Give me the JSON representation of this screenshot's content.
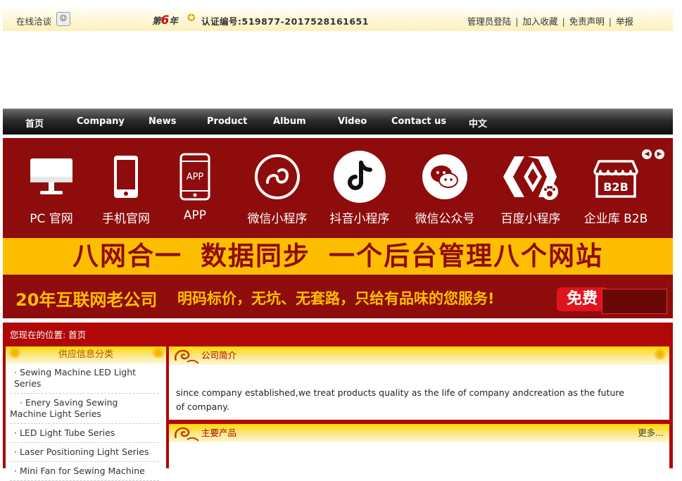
{
  "topbar": {
    "chat_label": "在线洽谈",
    "year_prefix": "第",
    "year_num": "6",
    "year_suffix": "年",
    "cert_label": "认证编号:519877-2017528161651",
    "links": [
      "管理员登陆",
      "加入收藏",
      "免责声明",
      "举报"
    ]
  },
  "nav": [
    "首页",
    "Company",
    "News",
    "Product",
    "Album",
    "Video",
    "Contact us",
    "中文"
  ],
  "banner": {
    "icons": [
      {
        "label": "PC 官网",
        "icon": "monitor-icon"
      },
      {
        "label": "手机官网",
        "icon": "mobile-icon"
      },
      {
        "label": "APP",
        "icon": "app-icon",
        "glyph_text": "APP"
      },
      {
        "label": "微信小程序",
        "icon": "wechat-miniprogram-icon"
      },
      {
        "label": "抖音小程序",
        "icon": "douyin-icon"
      },
      {
        "label": "微信公众号",
        "icon": "wechat-icon"
      },
      {
        "label": "百度小程序",
        "icon": "baidu-icon"
      },
      {
        "label": "企业库 B2B",
        "icon": "b2b-shop-icon",
        "glyph_text": "B2B"
      }
    ],
    "headline_parts": [
      "八网合一",
      "数据同步",
      "一个后台管理八个网站"
    ],
    "tagline_a": "20年互联网老公司",
    "tagline_b": "明码标价，无坑、无套路，只给有品味的您服务!",
    "free_label": "免费",
    "colors": {
      "dark_red": "#8e0c0c",
      "gold": "#fdbe00",
      "red": "#e0141e"
    }
  },
  "breadcrumb": "您现在的位置: 首页",
  "sidebar": {
    "title": "供应信息分类",
    "items": [
      "Sewing Machine LED Light Series",
      "Enery Saving Sewing Machine Light Series",
      "LED Light Tube Series",
      "Laser Positioning Light Series",
      "Mini Fan for Sewing Machine"
    ]
  },
  "intro": {
    "title": "公司简介",
    "text": "since company established,we treat products quality as the life of company andcreation as the future of company."
  },
  "products": {
    "title": "主要产品",
    "more": "更多..."
  }
}
